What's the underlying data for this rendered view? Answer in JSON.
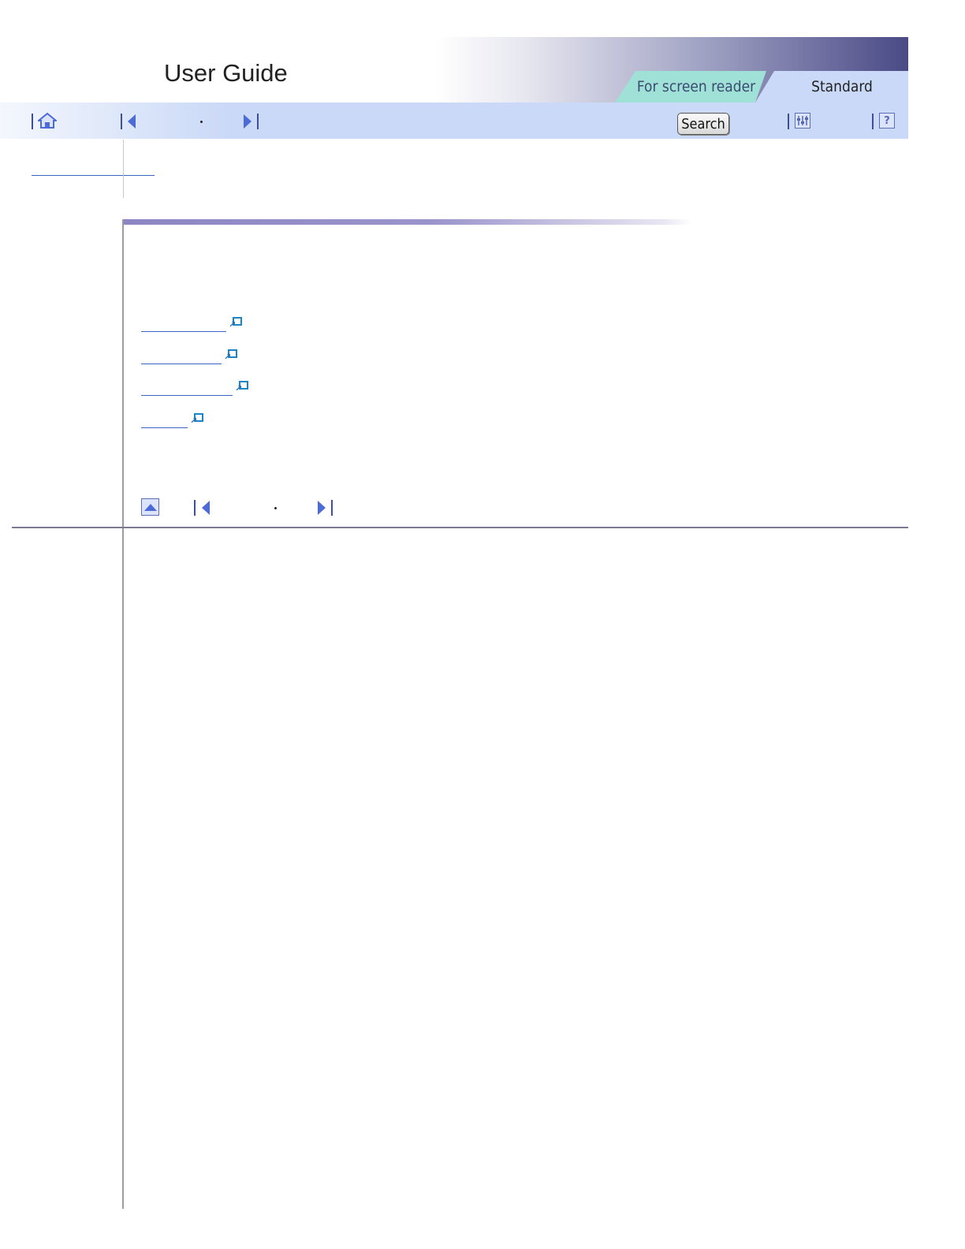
{
  "header": {
    "title": "User Guide",
    "tabs": [
      {
        "label": "For screen reader",
        "active": false
      },
      {
        "label": "Standard",
        "active": true
      }
    ]
  },
  "toolbar": {
    "search_label": "Search",
    "icons": [
      "home-icon",
      "previous-icon",
      "next-icon",
      "settings-icon",
      "help-icon"
    ]
  },
  "content": {
    "links": [
      {
        "has_external_icon": true
      },
      {
        "has_external_icon": true
      },
      {
        "has_external_icon": true
      },
      {
        "has_external_icon": true
      }
    ]
  },
  "colors": {
    "toolbar_bg": "#cad9f7",
    "tab_screen_reader": "#9fe0d7",
    "link": "#3a63c7",
    "section_bar": "#8c86c4",
    "banner_dark": "#4a4a86"
  }
}
